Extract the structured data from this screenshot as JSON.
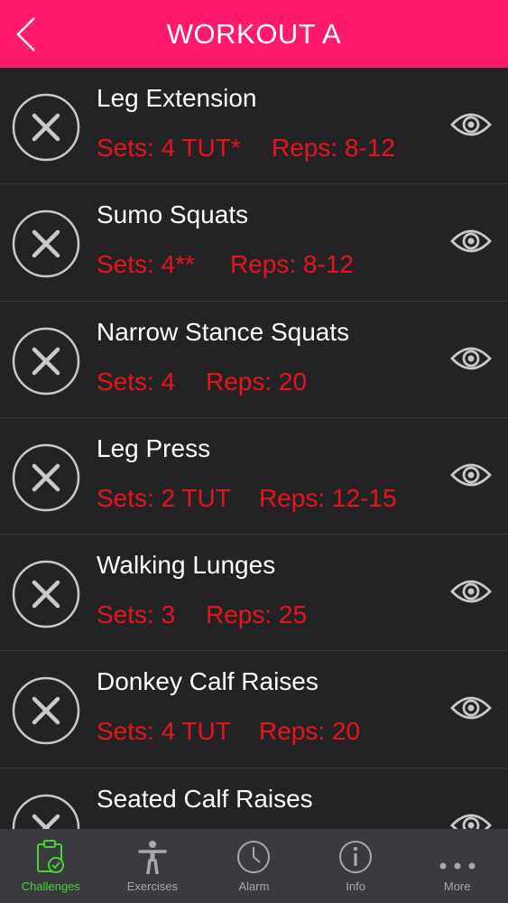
{
  "header": {
    "title": "WORKOUT A",
    "back_icon": "chevron-left-icon",
    "background": "#ff1a6b"
  },
  "colors": {
    "row_text": "#ffffff",
    "stat_text": "#e8141c",
    "active_tab": "#4cd137"
  },
  "exercises": [
    {
      "name": "Leg Extension",
      "sets": "Sets: 4 TUT*",
      "reps": "Reps: 8-12"
    },
    {
      "name": "Sumo Squats",
      "sets": "Sets: 4**",
      "reps": "Reps: 8-12"
    },
    {
      "name": "Narrow Stance Squats",
      "sets": "Sets: 4",
      "reps": "Reps: 20"
    },
    {
      "name": "Leg Press",
      "sets": "Sets: 2 TUT",
      "reps": "Reps: 12-15"
    },
    {
      "name": "Walking Lunges",
      "sets": "Sets: 3",
      "reps": "Reps: 25"
    },
    {
      "name": "Donkey Calf Raises",
      "sets": "Sets: 4 TUT",
      "reps": "Reps: 20"
    },
    {
      "name": "Seated Calf Raises",
      "sets": "",
      "reps": ""
    }
  ],
  "tabbar": {
    "tabs": [
      {
        "label": "Challenges",
        "icon": "clipboard-check-icon",
        "active": true
      },
      {
        "label": "Exercises",
        "icon": "person-icon",
        "active": false
      },
      {
        "label": "Alarm",
        "icon": "clock-icon",
        "active": false
      },
      {
        "label": "Info",
        "icon": "info-icon",
        "active": false
      },
      {
        "label": "More",
        "icon": "more-dots-icon",
        "active": false
      }
    ]
  }
}
